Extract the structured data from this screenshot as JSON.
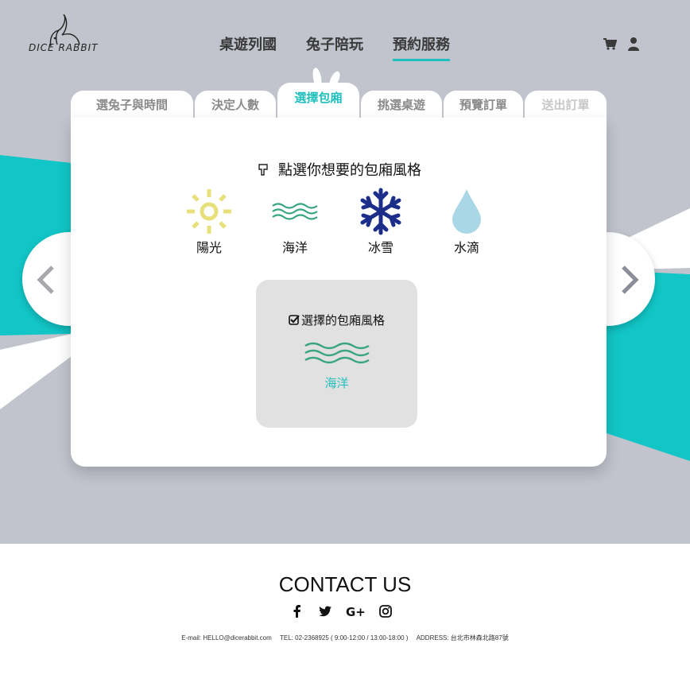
{
  "brand": {
    "name": "DICE RABBIT",
    "logo_icon": "rabbit-logo-icon"
  },
  "nav": {
    "items": [
      {
        "label": "桌遊列國",
        "active": false
      },
      {
        "label": "兔子陪玩",
        "active": false
      },
      {
        "label": "預約服務",
        "active": true
      }
    ],
    "icons": [
      "cart-icon",
      "user-icon"
    ]
  },
  "steps": {
    "tabs": [
      {
        "label": "選兔子與時間",
        "state": "done"
      },
      {
        "label": "決定人數",
        "state": "done"
      },
      {
        "label": "選擇包廂",
        "state": "active"
      },
      {
        "label": "挑選桌遊",
        "state": "pending"
      },
      {
        "label": "預覽訂單",
        "state": "pending"
      },
      {
        "label": "送出訂單",
        "state": "disabled"
      }
    ]
  },
  "room": {
    "prompt": "點選你想要的包廂風格",
    "prompt_icon": "pointing-hand-icon",
    "options": [
      {
        "label": "陽光",
        "icon": "sun-icon",
        "color": "#e8e07a"
      },
      {
        "label": "海洋",
        "icon": "waves-icon",
        "color": "#3aa67e"
      },
      {
        "label": "冰雪",
        "icon": "snowflake-icon",
        "color": "#1c2e8a"
      },
      {
        "label": "水滴",
        "icon": "water-drop-icon",
        "color": "#a9d7e6"
      }
    ],
    "selected_title": "選擇的包廂風格",
    "selected_value": "海洋",
    "selected_icon": "waves-icon"
  },
  "carousel": {
    "prev_icon": "chevron-left-icon",
    "next_icon": "chevron-right-icon"
  },
  "footer": {
    "title": "CONTACT US",
    "socials": [
      "facebook-icon",
      "twitter-icon",
      "google-plus-icon",
      "instagram-icon"
    ],
    "email": "E-mail: HELLO@dicerabbit.com",
    "tel": "TEL: 02-2368925 ( 9:00-12:00 / 13:00-18:00 )",
    "address": "ADDRESS: 台北市林森北路87號"
  },
  "colors": {
    "accent": "#1fbfbd",
    "background": "#c2c4cd",
    "teal_band": "#12c6c7",
    "sun": "#e8e07a",
    "waves": "#3aa67e",
    "snow": "#1c2e8a",
    "drop": "#a9d7e6"
  }
}
